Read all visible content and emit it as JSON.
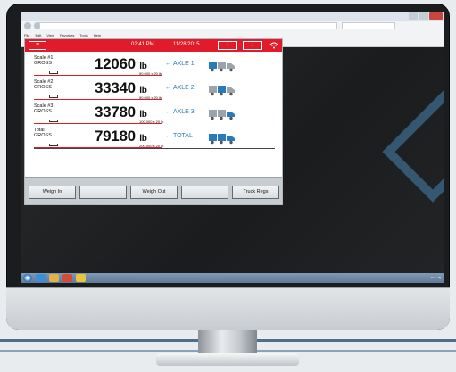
{
  "browser": {
    "menu": [
      "File",
      "Edit",
      "View",
      "Favorites",
      "Tools",
      "Help"
    ]
  },
  "app": {
    "menu_icon": "hamburger-icon",
    "time": "02:41 PM",
    "date": "11/28/2015",
    "up_icon": "arrow-up-icon",
    "down_icon": "arrow-down-icon",
    "wifi_icon": "wifi-icon",
    "accent_color": "#e21b2a",
    "axle_color": "#2a7bbd"
  },
  "scales": [
    {
      "label1": "Scale #1",
      "label2": "GROSS",
      "weight": "12060",
      "unit": "lb",
      "capacity": "50,000 x 20 lb",
      "target_label": "AXLE 1",
      "highlight": "rear"
    },
    {
      "label1": "Scale #2",
      "label2": "GROSS",
      "weight": "33340",
      "unit": "lb",
      "capacity": "50,000 x 20 lb",
      "target_label": "AXLE 2",
      "highlight": "middle"
    },
    {
      "label1": "Scale #3",
      "label2": "GROSS",
      "weight": "33780",
      "unit": "lb",
      "capacity": "100,000 x 20 lb",
      "target_label": "AXLE 3",
      "highlight": "front"
    },
    {
      "label1": "Total",
      "label2": "GROSS",
      "weight": "79180",
      "unit": "lb",
      "capacity": "200,000 x 20 lb",
      "target_label": "TOTAL",
      "highlight": "all"
    }
  ],
  "buttons": [
    "Weigh In",
    "",
    "Weigh Out",
    "",
    "Truck Regs"
  ]
}
